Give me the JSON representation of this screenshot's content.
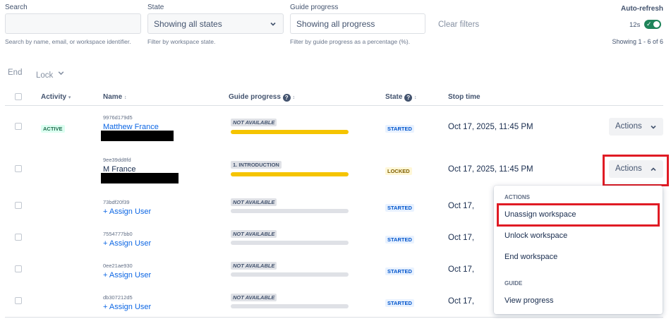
{
  "filters": {
    "search": {
      "label": "Search",
      "value": "",
      "placeholder": "",
      "help": "Search by name, email, or workspace identifier."
    },
    "state": {
      "label": "State",
      "value": "Showing all states",
      "help": "Filter by workspace state."
    },
    "progress": {
      "label": "Guide progress",
      "value": "Showing all progress",
      "help": "Filter by guide progress as a percentage (%)."
    },
    "clear_label": "Clear filters"
  },
  "auto_refresh": {
    "label": "Auto-refresh",
    "interval": "12s",
    "enabled": true,
    "showing": "Showing 1 - 6 of 6"
  },
  "bulk": {
    "end_label": "End",
    "lock_label": "Lock"
  },
  "table": {
    "headers": {
      "activity": "Activity",
      "name": "Name",
      "progress": "Guide progress",
      "state": "State",
      "stop_time": "Stop time"
    },
    "rows": [
      {
        "activity": "ACTIVE",
        "id": "9976d179d5",
        "name": "Matthew France",
        "progress_label": "NOT AVAILABLE",
        "progress_color": "#f5c400",
        "state": "STARTED",
        "stop_time": "Oct 17, 2025, 11:45 PM",
        "actions": "Actions"
      },
      {
        "activity": "",
        "id": "9ee39dd8fd",
        "name": "M France",
        "progress_label": "1. INTRODUCTION",
        "progress_color": "#f5c400",
        "state": "LOCKED",
        "stop_time": "Oct 17, 2025, 11:45 PM",
        "actions": "Actions"
      },
      {
        "activity": "",
        "id": "73bdf20f39",
        "name": "+ Assign User",
        "progress_label": "NOT AVAILABLE",
        "progress_color": "#dfe1e6",
        "state": "STARTED",
        "stop_time": "Oct 17,"
      },
      {
        "activity": "",
        "id": "7554777bb0",
        "name": "+ Assign User",
        "progress_label": "NOT AVAILABLE",
        "progress_color": "#dfe1e6",
        "state": "STARTED",
        "stop_time": "Oct 17,"
      },
      {
        "activity": "",
        "id": "0ee21ae930",
        "name": "+ Assign User",
        "progress_label": "NOT AVAILABLE",
        "progress_color": "#dfe1e6",
        "state": "STARTED",
        "stop_time": "Oct 17,"
      },
      {
        "activity": "",
        "id": "db307212d5",
        "name": "+ Assign User",
        "progress_label": "NOT AVAILABLE",
        "progress_color": "#dfe1e6",
        "state": "STARTED",
        "stop_time": "Oct 17,"
      }
    ]
  },
  "menu": {
    "section_actions": "ACTIONS",
    "unassign": "Unassign workspace",
    "unlock": "Unlock workspace",
    "end": "End workspace",
    "section_guide": "GUIDE",
    "view_progress": "View progress"
  },
  "colors": {
    "link": "#0c66e4",
    "highlight": "#e01b24",
    "toggle_on": "#1f845a",
    "progress_bar": "#f5c400"
  }
}
